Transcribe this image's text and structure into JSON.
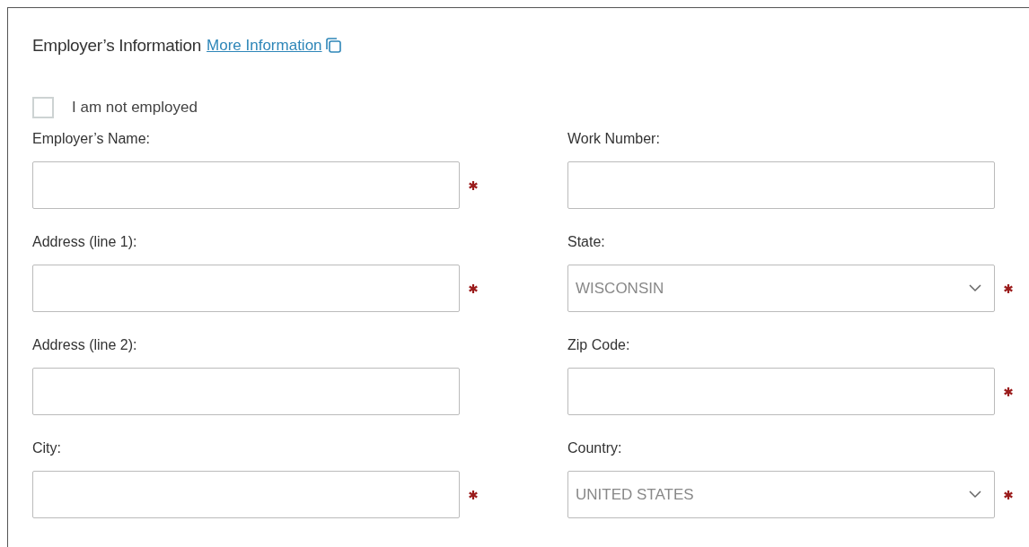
{
  "section": {
    "title": "Employer’s Information",
    "link": "More Information"
  },
  "not_employed": {
    "label": "I am not employed",
    "checked": false
  },
  "fields": [
    {
      "label": "Employer’s Name:",
      "kind": "text",
      "required": true
    },
    {
      "label": "Work Number:",
      "kind": "text",
      "required": false
    },
    {
      "label": "Address (line 1):",
      "kind": "text",
      "required": true
    },
    {
      "label": "State:",
      "kind": "select",
      "value": "WISCONSIN",
      "required": true
    },
    {
      "label": "Address (line 2):",
      "kind": "text",
      "required": false
    },
    {
      "label": "Zip Code:",
      "kind": "text",
      "required": true
    },
    {
      "label": "City:",
      "kind": "text",
      "required": true
    },
    {
      "label": "Country:",
      "kind": "select",
      "value": "UNITED STATES",
      "required": true
    }
  ]
}
